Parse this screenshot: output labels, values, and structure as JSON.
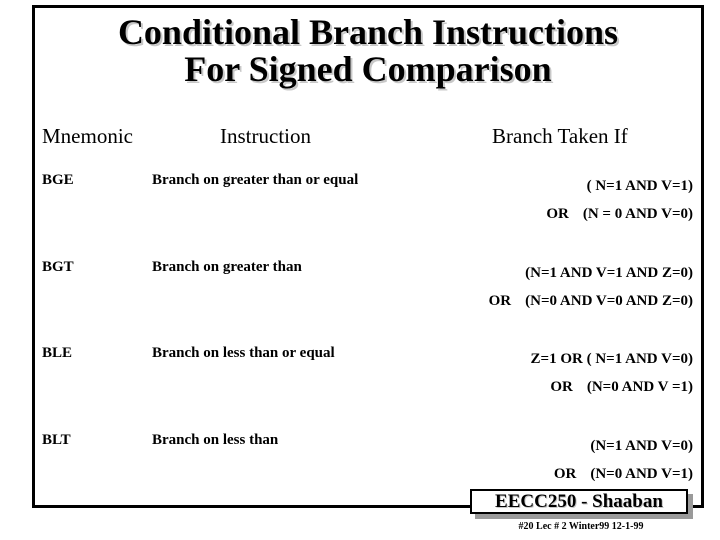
{
  "slide": {
    "title_lines": [
      "Conditional Branch Instructions",
      "For Signed Comparison"
    ]
  },
  "table": {
    "headers": {
      "mnemonic": "Mnemonic",
      "instruction": "Instruction",
      "branch_taken_if": "Branch Taken If"
    },
    "rows": [
      {
        "mnemonic": "BGE",
        "instruction": "Branch on greater than or equal",
        "conditions": [
          {
            "prefix": "",
            "text": "( N=1 AND V=1)"
          },
          {
            "prefix": "OR",
            "text": "(N = 0 AND V=0)"
          }
        ]
      },
      {
        "mnemonic": "BGT",
        "instruction": "Branch on greater than",
        "conditions": [
          {
            "prefix": "",
            "text": "(N=1 AND  V=1  AND Z=0)"
          },
          {
            "prefix": "OR",
            "text": "(N=0  AND V=0  AND Z=0)"
          }
        ]
      },
      {
        "mnemonic": "BLE",
        "instruction": "Branch on less than or equal",
        "conditions": [
          {
            "prefix": "",
            "text": "Z=1  OR  ( N=1  AND V=0)"
          },
          {
            "prefix": "OR",
            "text": "(N=0  AND V =1)"
          }
        ]
      },
      {
        "mnemonic": "BLT",
        "instruction": "Branch on less than",
        "conditions": [
          {
            "prefix": "",
            "text": "(N=1 AND V=0)"
          },
          {
            "prefix": "OR",
            "text": "(N=0  AND V=1)"
          }
        ]
      }
    ]
  },
  "footer": {
    "course_label": "EECC250 - Shaaban",
    "meta": "#20   Lec # 2   Winter99  12-1-99"
  },
  "colors": {
    "background": "#ffffff",
    "text": "#000000",
    "frame_border": "#000000",
    "title_shadow": "#c8c8c8",
    "badge_shadow": "#9a9a9a"
  }
}
